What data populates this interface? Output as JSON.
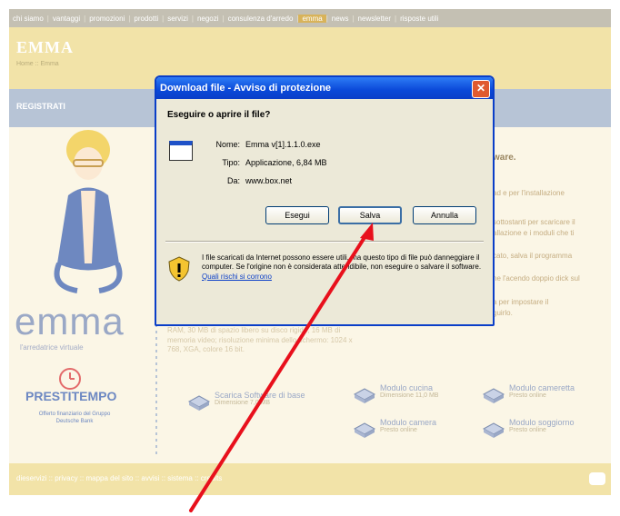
{
  "nav": {
    "items": [
      "chi siamo",
      "vantaggi",
      "promozioni",
      "prodotti",
      "servizi",
      "negozi",
      "consulenza d'arredo",
      "emma",
      "news",
      "newsletter",
      "risposte utili"
    ],
    "active_index": 7
  },
  "header": {
    "brand": "EMMA",
    "breadcrumb": "Home :: Emma"
  },
  "band": {
    "label": "REGISTRATI"
  },
  "left": {
    "logo": "emma",
    "logo_sub": "l'arredatrice virtuale",
    "sponsor": "PRESTITEMPO",
    "sponsor_sub": "Offerto finanziario del Gruppo Deutsche Bank"
  },
  "right_texts": [
    "ware.",
    "ad e per l'installazione",
    "sottostanti per scaricare il",
    "allazione e i moduli che ti",
    "cato, salva il programma",
    "ne l'acendo doppio dick sul",
    "a per impostare il",
    "guirlo."
  ],
  "specs": "2000 o XP ; Processore Pentium III con almeno 128 MB di RAM, 30 MB di spazio libero su disco rigido, 16 MB di memoria video; risoluzione minima dello schermo: 1024 x 768, XGA, colore 16 bit.",
  "downloads": [
    {
      "title": "Scarica Software di base",
      "sub": "Dimensione 7,0 MB"
    },
    {
      "title": "Modulo cucina",
      "sub": "Dimensione 11,0 MB"
    },
    {
      "title": "Modulo cameretta",
      "sub": "Presto online"
    },
    {
      "title": "Modulo camera",
      "sub": "Presto online"
    },
    {
      "title": "Modulo soggiorno",
      "sub": "Presto online"
    }
  ],
  "footer": {
    "text": "dieservizi :: privacy :: mappa del sito :: avvisi :: sistema :: credits"
  },
  "dialog": {
    "title": "Download file - Avviso di protezione",
    "question": "Eseguire o aprire il file?",
    "fields": [
      {
        "label": "Nome:",
        "value": "Emma v[1].1.1.0.exe"
      },
      {
        "label": "Tipo:",
        "value": "Applicazione, 6,84 MB"
      },
      {
        "label": "Da:",
        "value": "www.box.net"
      }
    ],
    "buttons": {
      "run": "Esegui",
      "save": "Salva",
      "cancel": "Annulla"
    },
    "warning": "I file scaricati da Internet possono essere utili, ma questo tipo di file può danneggiare il computer. Se l'origine non è considerata attendibile, non eseguire o salvare il software.",
    "warning_link": "Quali rischi si corrono"
  },
  "colors": {
    "annotation_arrow": "#e8101c",
    "dialog_frame": "#0a3ec8"
  }
}
